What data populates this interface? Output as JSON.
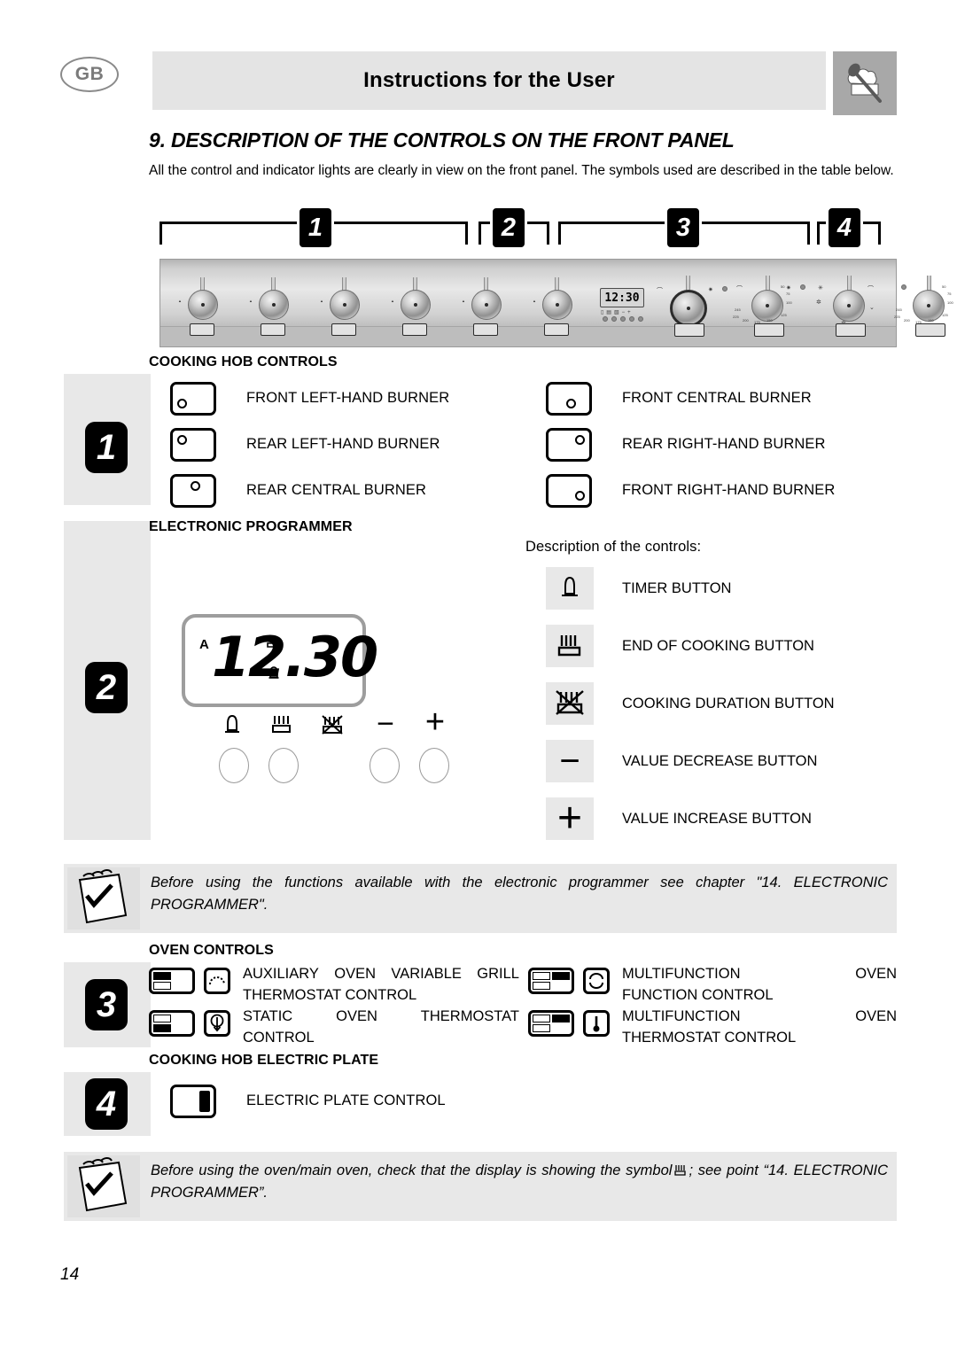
{
  "header": {
    "locale_badge": "GB",
    "title": "Instructions for the User",
    "chef_icon": "chef-hat-spoon-icon"
  },
  "section": {
    "number_title": "9. DESCRIPTION OF THE CONTROLS ON THE FRONT PANEL",
    "intro": "All the control and indicator lights are clearly in view on the front panel. The symbols used are described in the table below."
  },
  "callouts": [
    {
      "label": "1"
    },
    {
      "label": "2"
    },
    {
      "label": "3"
    },
    {
      "label": "4"
    }
  ],
  "panel_diagram": {
    "lcd_value": "12:30",
    "oven_knob_ticks": [
      "50",
      "75",
      "100",
      "125",
      "150",
      "175",
      "200",
      "225",
      "245"
    ]
  },
  "groups": {
    "hob": {
      "badge": "1",
      "heading": "COOKING HOB CONTROLS",
      "items": [
        {
          "icon": "burner-front-left-icon",
          "dot": "bottom-left",
          "label": "FRONT LEFT-HAND BURNER"
        },
        {
          "icon": "burner-rear-left-icon",
          "dot": "top-left",
          "label": "REAR LEFT-HAND BURNER"
        },
        {
          "icon": "burner-rear-central-icon",
          "dot": "top-center",
          "label": "REAR CENTRAL BURNER"
        },
        {
          "icon": "burner-front-central-icon",
          "dot": "bottom-center",
          "label": "FRONT CENTRAL BURNER"
        },
        {
          "icon": "burner-rear-right-icon",
          "dot": "top-right",
          "label": "REAR RIGHT-HAND BURNER"
        },
        {
          "icon": "burner-front-right-icon",
          "dot": "bottom-right",
          "label": "FRONT RIGHT-HAND BURNER"
        }
      ]
    },
    "programmer": {
      "badge": "2",
      "heading": "ELECTRONIC PROGRAMMER",
      "description_title": "Description of the controls:",
      "display": {
        "auto_indicator": "A",
        "time": "12.30"
      },
      "buttons": [
        {
          "icon": "timer-bell-icon",
          "label": "TIMER BUTTON"
        },
        {
          "icon": "end-of-cooking-icon",
          "label": "END OF COOKING BUTTON"
        },
        {
          "icon": "cooking-duration-icon",
          "label": "COOKING DURATION BUTTON"
        },
        {
          "icon": "minus-icon",
          "label": "VALUE DECREASE BUTTON"
        },
        {
          "icon": "plus-icon",
          "label": "VALUE INCREASE BUTTON"
        }
      ]
    },
    "oven": {
      "badge": "3",
      "heading": "OVEN CONTROLS",
      "items": [
        {
          "oven_cell": "top-left",
          "symbol": "variable-grill-icon",
          "label": "AUXILIARY OVEN VARIABLE GRILL THERMOSTAT CONTROL",
          "line1_words": [
            "AUXILIARY",
            "OVEN",
            "VARIABLE",
            "GRILL"
          ],
          "line2": "THERMOSTAT CONTROL"
        },
        {
          "oven_cell": "bottom-left",
          "symbol": "thermostat-down-icon",
          "label": "STATIC OVEN THERMOSTAT CONTROL",
          "line1_words": [
            "STATIC",
            "OVEN",
            "THERMOSTAT"
          ],
          "line2": "CONTROL"
        },
        {
          "oven_cell": "top-right",
          "symbol": "function-selector-icon",
          "label": "MULTIFUNCTION OVEN FUNCTION CONTROL",
          "line1_words": [
            "MULTIFUNCTION",
            "OVEN"
          ],
          "line2": "FUNCTION CONTROL"
        },
        {
          "oven_cell": "bottom-right",
          "symbol": "thermometer-icon",
          "label": "MULTIFUNCTION OVEN THERMOSTAT CONTROL",
          "line1_words": [
            "MULTIFUNCTION",
            "OVEN"
          ],
          "line2": "THERMOSTAT CONTROL"
        }
      ]
    },
    "electric_plate": {
      "badge": "4",
      "heading": "COOKING HOB ELECTRIC PLATE",
      "items": [
        {
          "icon": "electric-plate-icon",
          "label": "ELECTRIC PLATE CONTROL"
        }
      ]
    }
  },
  "notes": [
    {
      "icon": "notepad-check-icon",
      "text": "Before using the functions available with the electronic programmer see chapter \"14. ELECTRONIC PROGRAMMER\"."
    },
    {
      "icon": "notepad-check-icon",
      "text_before": "Before using the oven/main oven, check that the display is showing the symbol",
      "inline_symbol": "end-of-cooking-icon",
      "text_after": "; see point “14. ELECTRONIC PROGRAMMER”."
    }
  ],
  "footer": {
    "page_number": "14"
  }
}
